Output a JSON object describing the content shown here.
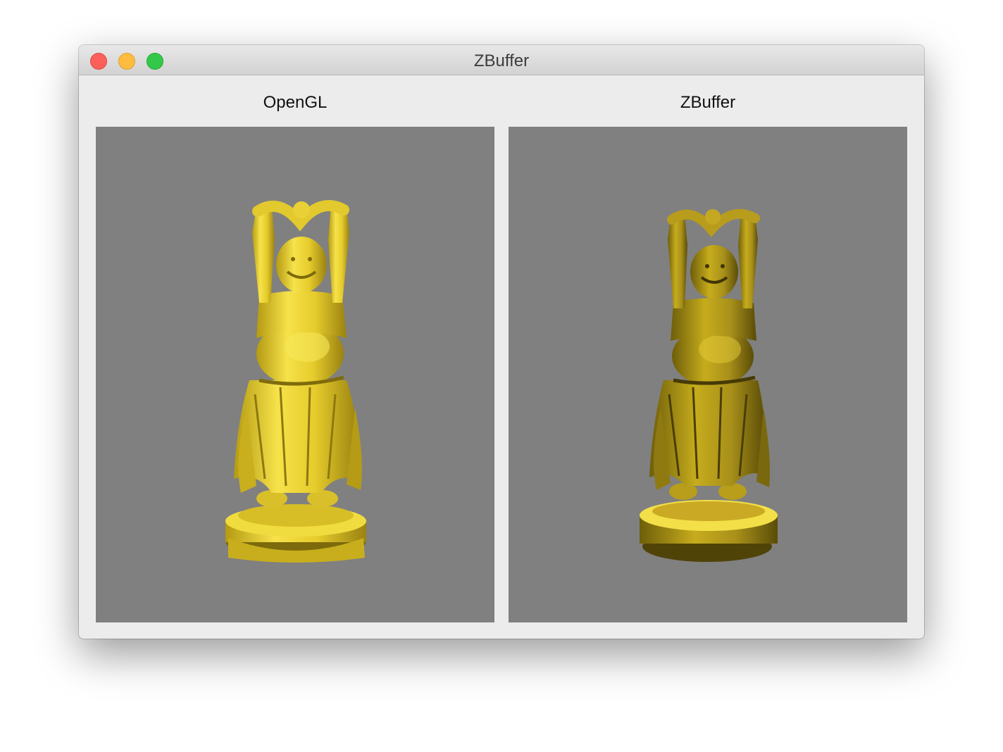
{
  "window": {
    "title": "ZBuffer"
  },
  "panels": [
    {
      "label": "OpenGL",
      "view": "opengl-render"
    },
    {
      "label": "ZBuffer",
      "view": "zbuffer-render"
    }
  ],
  "colors": {
    "viewport_background": "#808080",
    "model_gold": "#f2dc3a",
    "model_shadow": "#8a7a10"
  }
}
